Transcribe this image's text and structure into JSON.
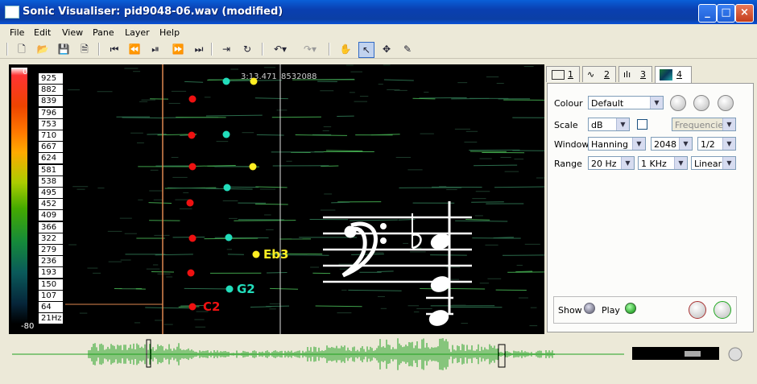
{
  "window": {
    "title": "Sonic Visualiser: pid9048-06.wav (modified)"
  },
  "menu": [
    "File",
    "Edit",
    "View",
    "Pane",
    "Layer",
    "Help"
  ],
  "toolbar_icons": [
    "new-file-icon",
    "open-file-icon",
    "save-icon",
    "save-session-icon",
    "rewind-start-icon",
    "rewind-icon",
    "play-pause-icon",
    "fast-forward-icon",
    "fast-forward-end-icon",
    "play-selection-icon",
    "loop-icon",
    "undo-icon",
    "redo-icon",
    "navigate-hand-icon",
    "select-arrow-icon",
    "move-icon",
    "draw-pencil-icon"
  ],
  "colour_scale": {
    "top": "0",
    "bottom": "-80"
  },
  "freq_labels": [
    "925",
    "882",
    "839",
    "796",
    "753",
    "710",
    "667",
    "624",
    "581",
    "538",
    "495",
    "452",
    "409",
    "366",
    "322",
    "279",
    "236",
    "193",
    "150",
    "107",
    "64",
    "21Hz"
  ],
  "readout": {
    "time": "3:13.471",
    "frame": "8532088"
  },
  "notes": {
    "c2": "C2",
    "g2": "G2",
    "eb3": "Eb3"
  },
  "tabs": [
    {
      "label": "1"
    },
    {
      "label": "2"
    },
    {
      "label": "3"
    },
    {
      "label": "4"
    }
  ],
  "layer_props": {
    "colour_label": "Colour",
    "colour_value": "Default",
    "scale_label": "Scale",
    "scale_value": "dB",
    "frequencies_value": "Frequencies",
    "window_label": "Window",
    "window_type": "Hanning",
    "window_size": "2048",
    "window_overlap": "1/2",
    "range_label": "Range",
    "range_min": "20 Hz",
    "range_max": "1 KHz",
    "range_scale": "Linear",
    "show_label": "Show",
    "play_label": "Play"
  },
  "colors": {
    "title_blue": "#0a3fb0",
    "dot_red": "#ee1111",
    "dot_cyan": "#22ddbb",
    "dot_yellow": "#ffee22",
    "waveform": "#1fa11f"
  }
}
